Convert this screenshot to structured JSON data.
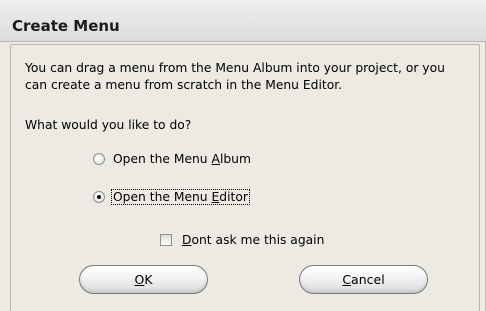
{
  "dialog": {
    "title": "Create Menu",
    "description": "You can drag a menu from the Menu Album into your project, or you can create a menu from scratch in the Menu Editor.",
    "question": "What would you like to do?"
  },
  "options": [
    {
      "pre": "Open the Menu ",
      "key": "A",
      "post": "lbum",
      "selected": false
    },
    {
      "pre": "Open the Menu ",
      "key": "E",
      "post": "ditor",
      "selected": true
    }
  ],
  "dont_ask": {
    "key": "D",
    "post": "ont ask me this again",
    "checked": false
  },
  "buttons": {
    "ok": {
      "key": "O",
      "post": "K"
    },
    "cancel": {
      "key": "C",
      "post": "ancel"
    }
  }
}
